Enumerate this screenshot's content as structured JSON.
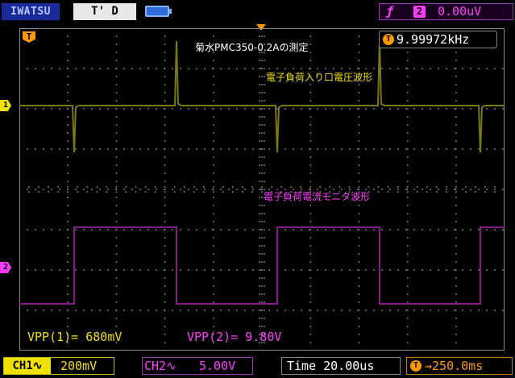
{
  "top": {
    "brand": "IWATSU",
    "trigger_mode": "T' D",
    "battery_icon": "battery-icon",
    "trigger_edge_icon": "rising-edge-icon",
    "trigger_source": "2",
    "trigger_level": "0.00uV"
  },
  "plot": {
    "ch1_marker": "1",
    "ch2_marker": "2",
    "trigger_time_marker": "T",
    "frequency_icon": "T",
    "frequency": "9.99972kHz",
    "annotation_title": "菊水PMC350-0.2Aの測定",
    "annotation_ch1": "電子負荷入り口電圧波形",
    "annotation_ch2": "電子負荷電流モニタ波形",
    "colors": {
      "ch1": "#f0e000",
      "ch2": "#ff3cff",
      "trigger": "#ff9900",
      "grid": "#808080"
    }
  },
  "measurements": {
    "ch1": "VPP(1)= 680mV",
    "ch2": "VPP(2)= 9.80V"
  },
  "bottom": {
    "ch1_label": "CH1∿",
    "ch1_scale": "200mV",
    "ch2_label": "CH2∿",
    "ch2_scale": "5.00V",
    "timebase": "Time 20.00us",
    "delay_icon": "T",
    "delay": "→250.0ms"
  }
}
